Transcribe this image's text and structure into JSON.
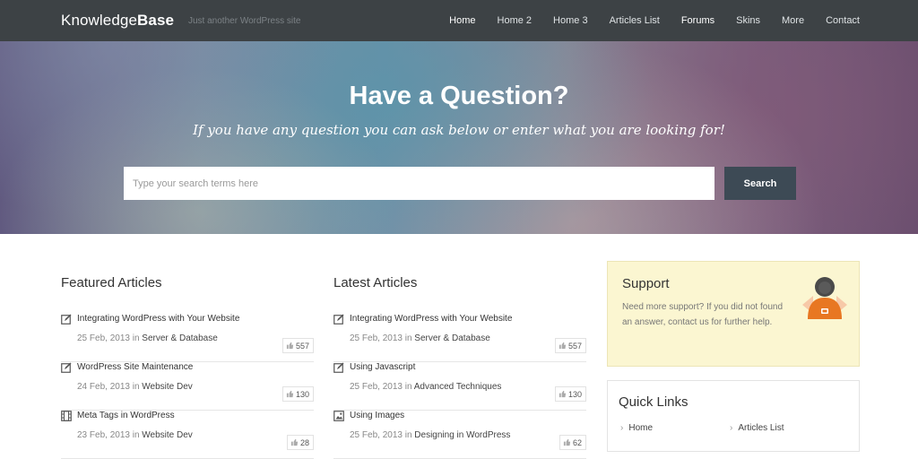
{
  "header": {
    "logo_light": "Knowledge",
    "logo_bold": "Base",
    "tagline": "Just another WordPress site",
    "nav": [
      "Home",
      "Home 2",
      "Home 3",
      "Articles List",
      "Forums",
      "Skins",
      "More",
      "Contact"
    ]
  },
  "hero": {
    "title": "Have a Question?",
    "subtitle": "If you have any question you can ask below or enter what you are looking for!",
    "search_placeholder": "Type your search terms here",
    "search_button": "Search"
  },
  "featured": {
    "title": "Featured Articles",
    "items": [
      {
        "title": "Integrating WordPress with Your Website",
        "date": "25 Feb, 2013",
        "in": "in",
        "category": "Server & Database",
        "likes": "557",
        "icon": "edit-icon"
      },
      {
        "title": "WordPress Site Maintenance",
        "date": "24 Feb, 2013",
        "in": "in",
        "category": "Website Dev",
        "likes": "130",
        "icon": "edit-icon"
      },
      {
        "title": "Meta Tags in WordPress",
        "date": "23 Feb, 2013",
        "in": "in",
        "category": "Website Dev",
        "likes": "28",
        "icon": "film-icon"
      }
    ]
  },
  "latest": {
    "title": "Latest Articles",
    "items": [
      {
        "title": "Integrating WordPress with Your Website",
        "date": "25 Feb, 2013",
        "in": "in",
        "category": "Server & Database",
        "likes": "557",
        "icon": "edit-icon"
      },
      {
        "title": "Using Javascript",
        "date": "25 Feb, 2013",
        "in": "in",
        "category": "Advanced Techniques",
        "likes": "130",
        "icon": "edit-icon"
      },
      {
        "title": "Using Images",
        "date": "25 Feb, 2013",
        "in": "in",
        "category": "Designing in WordPress",
        "likes": "62",
        "icon": "image-icon"
      }
    ]
  },
  "support": {
    "title": "Support",
    "text": "Need more support? If you did not found an answer, contact us for further help."
  },
  "quick_links": {
    "title": "Quick Links",
    "links": [
      "Home",
      "Articles List"
    ]
  },
  "colors": {
    "header_bg": "#3d4245",
    "search_button_bg": "#3d4a55",
    "support_bg": "#fbf6d1"
  }
}
